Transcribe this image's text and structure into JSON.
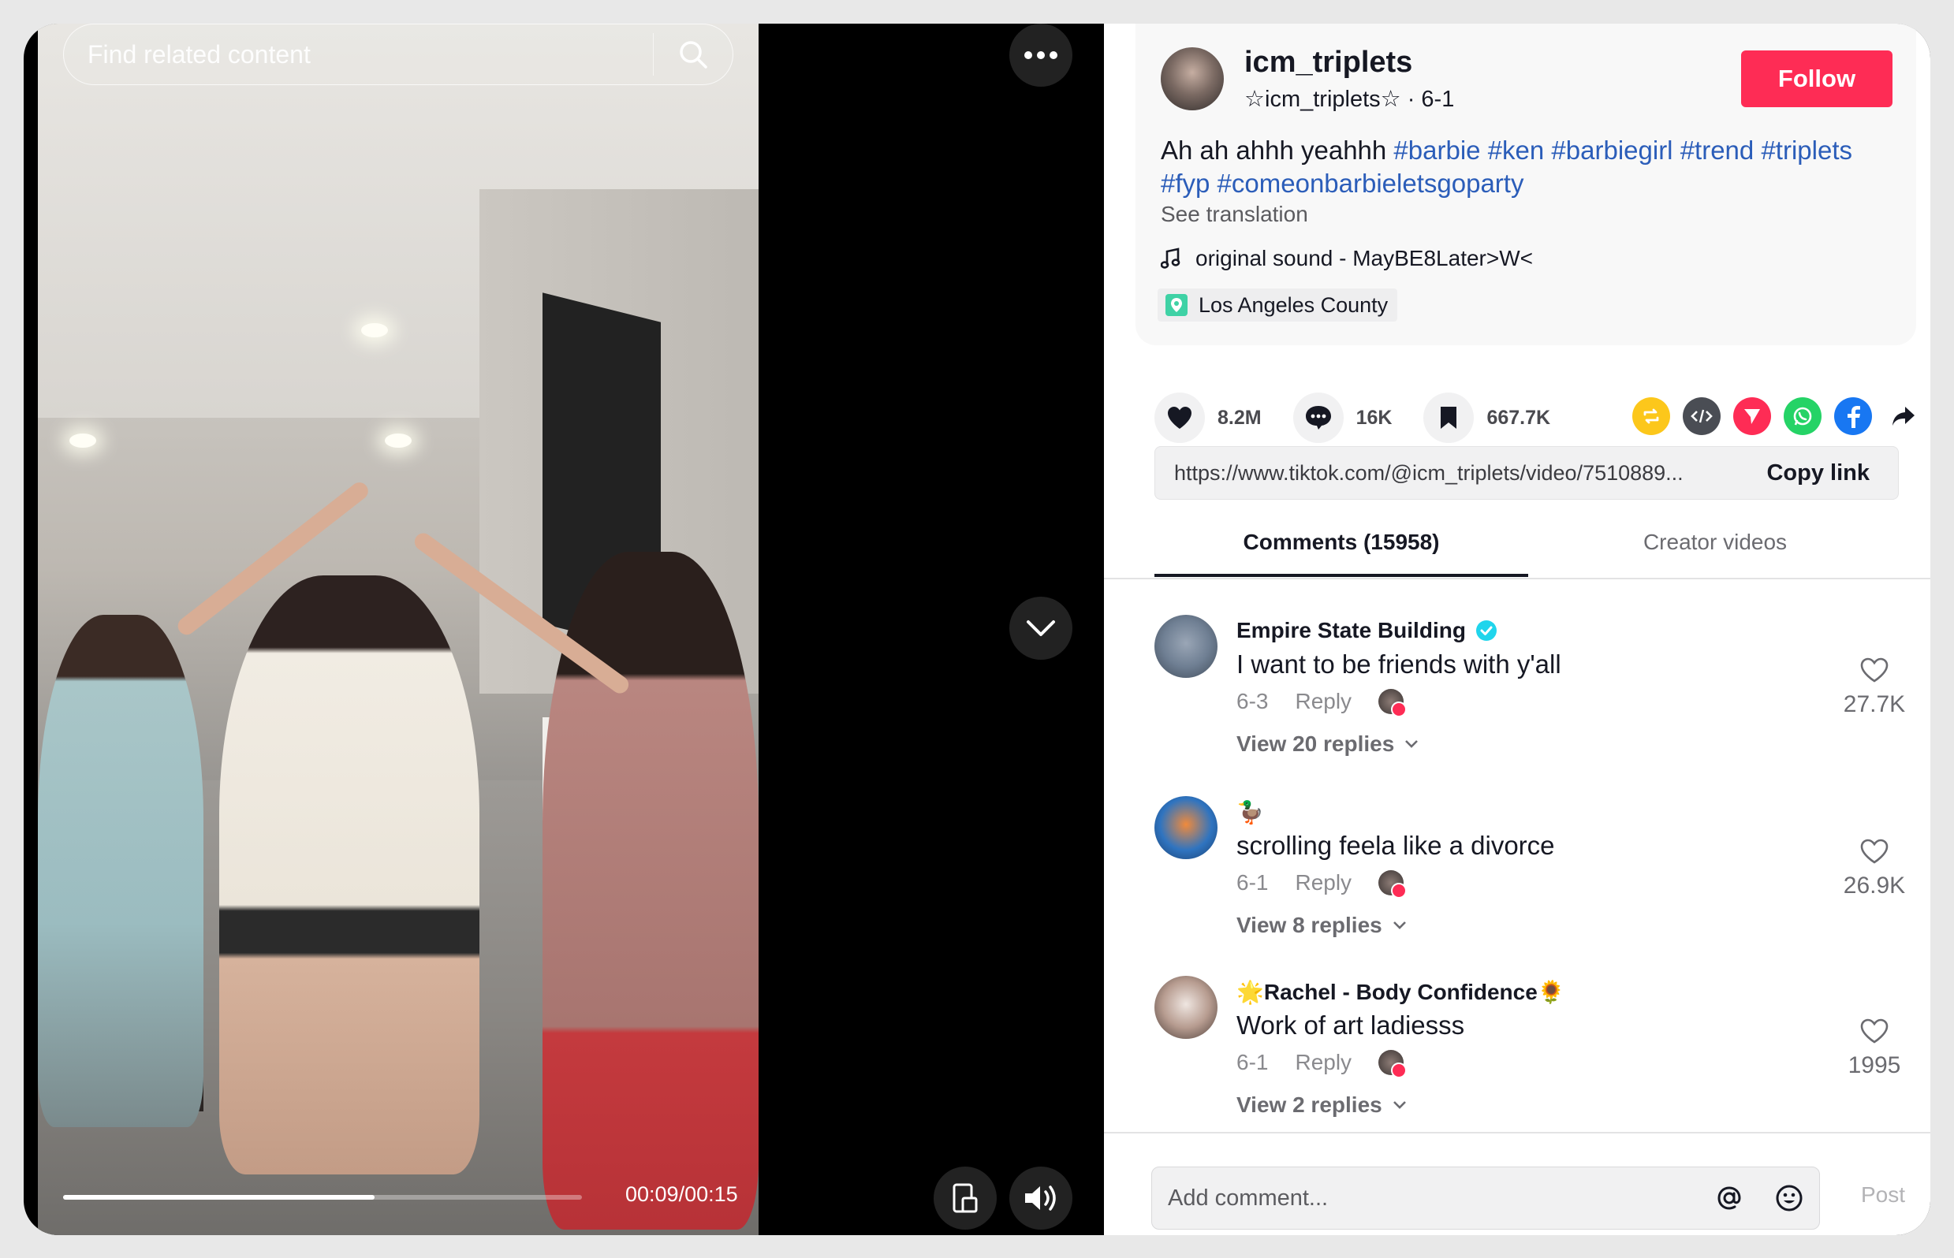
{
  "video": {
    "search_placeholder": "Find related content",
    "timecode": "00:09/00:15",
    "progress_fraction": 0.6
  },
  "author": {
    "username": "icm_triplets",
    "nickname_line": "☆icm_triplets☆ · 6-1",
    "follow_label": "Follow"
  },
  "description": {
    "text": "Ah ah ahhh yeahhh ",
    "hashtags": [
      "#barbie",
      "#ken",
      "#barbiegirl",
      "#trend",
      "#triplets",
      "#fyp",
      "#comeonbarbieletsgoparty"
    ],
    "see_translation": "See translation",
    "music": "original sound - MayBE8Later>W<",
    "location": "Los Angeles County"
  },
  "stats": {
    "likes": "8.2M",
    "comments": "16K",
    "saves": "667.7K"
  },
  "share": {
    "url": "https://www.tiktok.com/@icm_triplets/video/7510889...",
    "copy_label": "Copy link"
  },
  "tabs": {
    "comments": "Comments (15958)",
    "creator_videos": "Creator videos"
  },
  "comments": [
    {
      "name": "Empire State Building",
      "verified": true,
      "text": "I want to be friends with y'all",
      "date": "6-3",
      "reply_label": "Reply",
      "replies": "View 20 replies",
      "likes": "27.7K"
    },
    {
      "name": "🦆",
      "verified": false,
      "text": "scrolling feela like a divorce",
      "date": "6-1",
      "reply_label": "Reply",
      "replies": "View 8 replies",
      "likes": "26.9K"
    },
    {
      "name": "🌟Rachel - Body Confidence🌻",
      "verified": false,
      "text": "Work of art ladiesss",
      "date": "6-1",
      "reply_label": "Reply",
      "replies": "View 2 replies",
      "likes": "1995"
    }
  ],
  "composer": {
    "placeholder": "Add comment...",
    "post_label": "Post"
  },
  "colors": {
    "accent": "#fe2c55",
    "hashtag": "#2b5db9"
  }
}
